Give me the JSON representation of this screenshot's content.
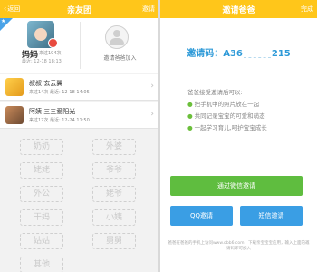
{
  "left": {
    "navbar": {
      "back_label": "返回",
      "title": "亲友团",
      "action_label": "邀请"
    },
    "mom": {
      "name": "妈妈",
      "visit": "来过194次",
      "time": "最近: 12-18 18:13"
    },
    "invite": {
      "label": "邀请爸爸加入"
    },
    "members": [
      {
        "name": "叔叔  玄云翼",
        "meta": "来过14次   最近: 12-18 14:05"
      },
      {
        "name": "阿姨  三三爱阳光",
        "meta": "来过17次   最近: 12-24 11:50"
      }
    ],
    "roles": [
      "奶奶",
      "外婆",
      "姥姥",
      "爷爷",
      "外公",
      "姥爷",
      "干妈",
      "小姨",
      "姑姑",
      "舅舅",
      "其他"
    ]
  },
  "right": {
    "navbar": {
      "title": "邀请爸爸",
      "action_label": "完成"
    },
    "invite_code": {
      "label": "邀请码：A36",
      "tail": "215"
    },
    "benefits_title": "爸爸接受邀请后可以:",
    "benefits": [
      "把手机中的照片放在一起",
      "共同记录宝宝的可爱和萌态",
      "一起学习育儿,呵护宝宝成长"
    ],
    "buttons": {
      "wechat": "通过微信邀请",
      "qq": "QQ邀请",
      "sms": "短信邀请"
    },
    "footer": "爸爸在爸爸的手机上访问www.qbb6.com，下载亲宝宝宝应用，输入上面的邀请码即可加入"
  },
  "colors": {
    "nav": "#ffc61a",
    "blue": "#3a9ee4",
    "green": "#5fbd3f"
  }
}
